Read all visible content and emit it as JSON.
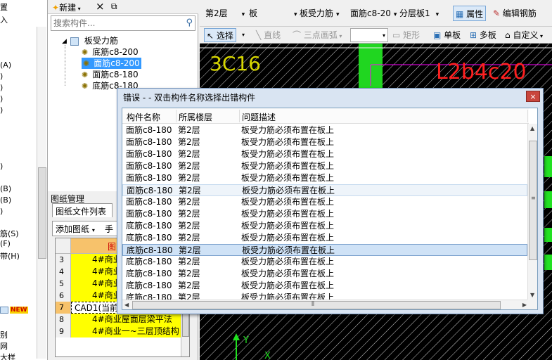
{
  "left_strip": {
    "items": [
      "置",
      "入",
      "(A)",
      ")",
      ")",
      ")",
      ")",
      ")",
      "(B)",
      "(B)",
      ")",
      "筋(S)",
      "(F)",
      "带(H)",
      "别",
      "网",
      "大样"
    ],
    "new_badge": "NEW"
  },
  "tree": {
    "toolbar": {
      "new_label": "新建",
      "delete_icon": "×",
      "copy_icon": "⧉"
    },
    "search_placeholder": "搜索构件...",
    "root": "板受力筋",
    "children": [
      "底筋c8-200",
      "面筋c8-200",
      "面筋c8-180",
      "底筋c8-180"
    ],
    "selected_index": 1
  },
  "drawing_panel": {
    "title": "图纸管理",
    "tab": "图纸文件列表",
    "add_button": "添加图纸",
    "manual_button": "手",
    "header": "图",
    "rows": [
      {
        "num": "3",
        "name": "4#商业"
      },
      {
        "num": "4",
        "name": "4#商业"
      },
      {
        "num": "5",
        "name": "4#商业"
      },
      {
        "num": "6",
        "name": "4#商业"
      },
      {
        "num": "7",
        "name": "CAD1(当前图纸)"
      },
      {
        "num": "8",
        "name": "4#商业屋面层梁平法"
      },
      {
        "num": "9",
        "name": "4#商业一~三层顶结构"
      }
    ]
  },
  "toolbar1": {
    "floor": "第2层",
    "type": "板",
    "sub_type": "板受力筋",
    "component": "面筋c8-20",
    "layer": "分层板1",
    "property_button": "属性",
    "edit_rebar_button": "编辑钢筋"
  },
  "toolbar2": {
    "select_button": "选择",
    "line_button": "直线",
    "arc_button": "三点画弧",
    "rect_button": "矩形",
    "single_board_button": "单板",
    "multi_board_button": "多板",
    "custom_button": "自定义"
  },
  "cad": {
    "label_3c16": "3C16",
    "label_right": "L2b4c20",
    "axis_y": "Y",
    "axis_x": "X"
  },
  "dialog": {
    "title": "错误 - - 双击构件名称选择出错构件",
    "close": "×",
    "columns": [
      "构件名称",
      "所属楼层",
      "问题描述"
    ],
    "rows": [
      [
        "面筋c8-180",
        "第2层",
        "板受力筋必须布置在板上"
      ],
      [
        "面筋c8-180",
        "第2层",
        "板受力筋必须布置在板上"
      ],
      [
        "面筋c8-180",
        "第2层",
        "板受力筋必须布置在板上"
      ],
      [
        "面筋c8-180",
        "第2层",
        "板受力筋必须布置在板上"
      ],
      [
        "面筋c8-180",
        "第2层",
        "板受力筋必须布置在板上"
      ],
      [
        "面筋c8-180",
        "第2层",
        "板受力筋必须布置在板上"
      ],
      [
        "面筋c8-180",
        "第2层",
        "板受力筋必须布置在板上"
      ],
      [
        "面筋c8-180",
        "第2层",
        "板受力筋必须布置在板上"
      ],
      [
        "底筋c8-180",
        "第2层",
        "板受力筋必须布置在板上"
      ],
      [
        "底筋c8-180",
        "第2层",
        "板受力筋必须布置在板上"
      ],
      [
        "底筋c8-180",
        "第2层",
        "板受力筋必须布置在板上"
      ],
      [
        "底筋c8-180",
        "第2层",
        "板受力筋必须布置在板上"
      ],
      [
        "底筋c8-180",
        "第2层",
        "板受力筋必须布置在板上"
      ],
      [
        "底筋c8-180",
        "第2层",
        "板受力筋必须布置在板上"
      ],
      [
        "底筋c8-180",
        "第2层",
        "板受力筋必须布置在板上"
      ]
    ],
    "hover_row": 5,
    "selected_row": 10
  }
}
